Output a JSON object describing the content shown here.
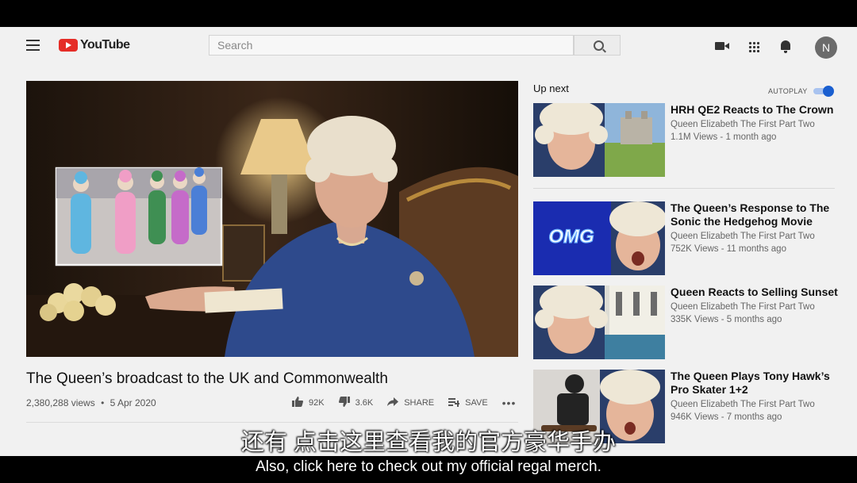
{
  "header": {
    "logo_text": "YouTube",
    "search_placeholder": "Search",
    "avatar_initial": "N"
  },
  "video": {
    "title": "The Queen’s broadcast to the UK and Commonwealth",
    "views": "2,380,288 views",
    "date": "5 Apr 2020",
    "dot": "•",
    "likes": "92K",
    "dislikes": "3.6K",
    "share_label": "SHARE",
    "save_label": "SAVE"
  },
  "sidebar": {
    "up_next_label": "Up next",
    "autoplay_label": "AUTOPLAY",
    "autoplay_on": true,
    "items": [
      {
        "title": "HRH QE2 Reacts to The Crown",
        "channel": "Queen Elizabeth The First Part Two",
        "meta": "1.1M Views - 1 month ago",
        "thumb_text": ""
      },
      {
        "title": "The Queen’s Response to The Sonic the Hedgehog Movie",
        "channel": "Queen Elizabeth The First Part Two",
        "meta": "752K Views - 11 months ago",
        "thumb_text": "OMG"
      },
      {
        "title": "Queen Reacts to Selling Sunset",
        "channel": "Queen Elizabeth The First Part Two",
        "meta": "335K Views - 5 months ago",
        "thumb_text": ""
      },
      {
        "title": "The Queen Plays Tony Hawk’s Pro Skater 1+2",
        "channel": "Queen Elizabeth The First Part Two",
        "meta": "946K Views - 7 months ago",
        "thumb_text": ""
      }
    ]
  },
  "subtitles": {
    "chinese": "还有 点击这里查看我的官方豪华手办",
    "english": "Also, click here to check out my official regal merch."
  },
  "colors": {
    "logo_red": "#e52d27",
    "toggle_blue": "#1a5fd0",
    "omg_blue": "#1d35c8"
  }
}
